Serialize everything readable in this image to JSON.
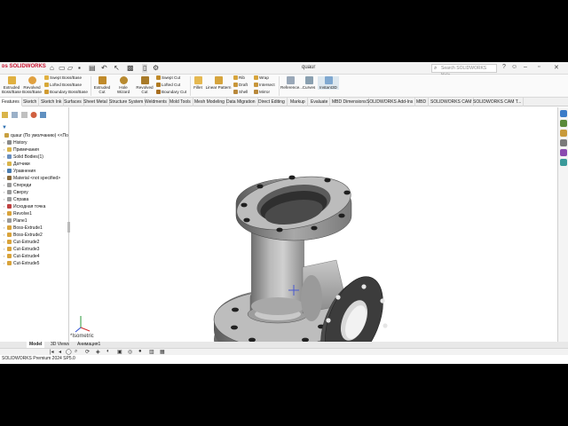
{
  "app": {
    "logo_text": "SOLIDWORKS",
    "document_title": "quaur",
    "search_placeholder": "Search SOLIDWORKS Help"
  },
  "ribbon": {
    "buttons": [
      {
        "label": "Extruded Boss/Base"
      },
      {
        "label": "Revolved Boss/Base"
      },
      {
        "label": "Extruded Cut"
      },
      {
        "label": "Hole Wizard"
      },
      {
        "label": "Revolved Cut"
      },
      {
        "label": "Fillet"
      },
      {
        "label": "Linear Pattern"
      },
      {
        "label": "Reference..."
      },
      {
        "label": "Curves"
      },
      {
        "label": "Instant3D"
      }
    ],
    "small": [
      {
        "label": "Swept Boss/Base"
      },
      {
        "label": "Lofted Boss/Base"
      },
      {
        "label": "Boundary Boss/Base"
      },
      {
        "label": "Swept Cut"
      },
      {
        "label": "Lofted Cut"
      },
      {
        "label": "Boundary Cut"
      },
      {
        "label": "Rib"
      },
      {
        "label": "Draft"
      },
      {
        "label": "Shell"
      },
      {
        "label": "Wrap"
      },
      {
        "label": "Intersect"
      },
      {
        "label": "Mirror"
      }
    ]
  },
  "tabs": [
    "Features",
    "Sketch",
    "Sketch Ink",
    "Surfaces",
    "Sheet Metal",
    "Structure System",
    "Weldments",
    "Mold Tools",
    "Mesh Modeling",
    "Data Migration",
    "Direct Editing",
    "Markup",
    "Evaluate",
    "MBD Dimensions",
    "SOLIDWORKS Add-Ins",
    "MBD",
    "SOLIDWORKS CAM",
    "SOLIDWORKS CAM T..."
  ],
  "tree": {
    "items": [
      {
        "label": "quaur (По умолчанию) <<По",
        "color": "#c8a040",
        "level": 0
      },
      {
        "label": "History",
        "color": "#8a8a8a",
        "level": 1
      },
      {
        "label": "Примечания",
        "color": "#d9b44a",
        "level": 1
      },
      {
        "label": "Solid Bodies(1)",
        "color": "#6a8fbf",
        "level": 1
      },
      {
        "label": "Датчики",
        "color": "#d9b44a",
        "level": 1
      },
      {
        "label": "Уравнения",
        "color": "#4a7db0",
        "level": 1
      },
      {
        "label": "Material <not specified>",
        "color": "#8a6a3a",
        "level": 1
      },
      {
        "label": "Спереди",
        "color": "#9a9a9a",
        "level": 1
      },
      {
        "label": "Сверху",
        "color": "#9a9a9a",
        "level": 1
      },
      {
        "label": "Справа",
        "color": "#9a9a9a",
        "level": 1
      },
      {
        "label": "Исходная точка",
        "color": "#c04040",
        "level": 1
      },
      {
        "label": "Revolve1",
        "color": "#d9a33a",
        "level": 1
      },
      {
        "label": "Plane1",
        "color": "#9a9a9a",
        "level": 1
      },
      {
        "label": "Boss-Extrude1",
        "color": "#d9a33a",
        "level": 1
      },
      {
        "label": "Boss-Extrude2",
        "color": "#d9a33a",
        "level": 1
      },
      {
        "label": "Cut-Extrude2",
        "color": "#d9a33a",
        "level": 1
      },
      {
        "label": "Cut-Extrude3",
        "color": "#d9a33a",
        "level": 1
      },
      {
        "label": "Cut-Extrude4",
        "color": "#d9a33a",
        "level": 1
      },
      {
        "label": "Cut-Extrude5",
        "color": "#d9a33a",
        "level": 1
      }
    ]
  },
  "bottom_tabs": [
    "Model",
    "3D Views",
    "Анимация1"
  ],
  "status": {
    "text": "SOLIDWORKS Premium 2024 SP5.0"
  },
  "viewport": {
    "view_label": "*Isometric"
  }
}
